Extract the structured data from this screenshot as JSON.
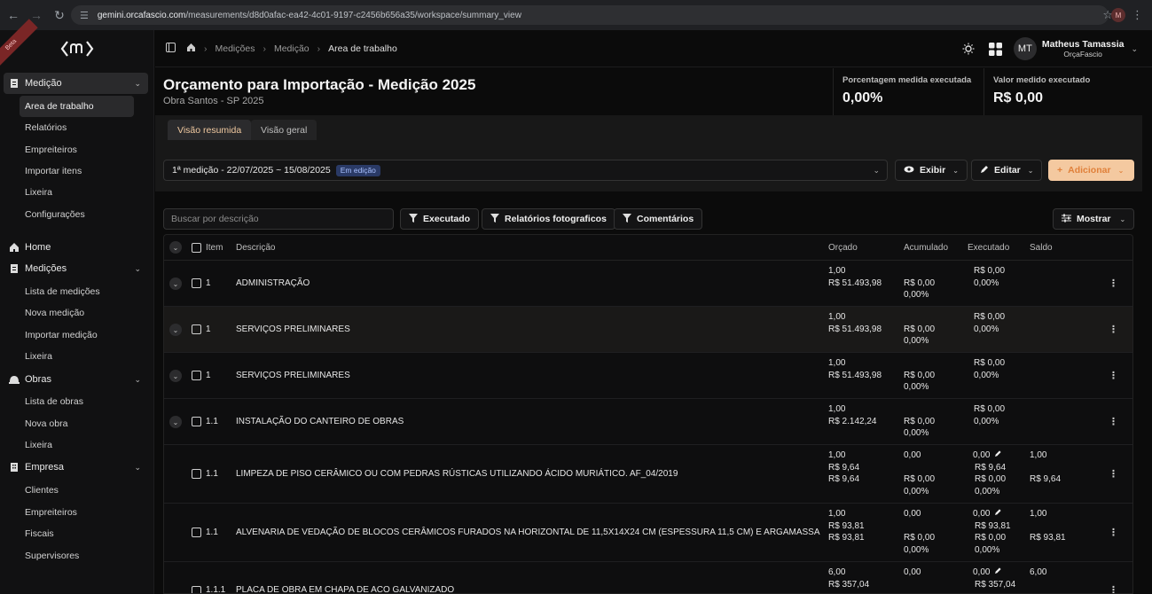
{
  "browser": {
    "url_host": "gemini.orcafascio.com",
    "url_path": "/measurements/d8d0afac-ea42-4c01-9197-c2456b656a35/workspace/summary_view",
    "profile_initial": "M"
  },
  "sidebar": {
    "ribbon": "Beta",
    "sections": [
      {
        "label": "Medição",
        "items": [
          "Area de trabalho",
          "Relatórios",
          "Empreiteiros",
          "Importar itens",
          "Lixeira",
          "Configurações"
        ]
      },
      {
        "label": "Home",
        "items": []
      },
      {
        "label": "Medições",
        "items": [
          "Lista de medições",
          "Nova medição",
          "Importar medição",
          "Lixeira"
        ]
      },
      {
        "label": "Obras",
        "items": [
          "Lista de obras",
          "Nova obra",
          "Lixeira"
        ]
      },
      {
        "label": "Empresa",
        "items": [
          "Clientes",
          "Empreiteiros",
          "Fiscais",
          "Supervisores"
        ]
      }
    ]
  },
  "header": {
    "breadcrumbs": [
      "Medições",
      "Medição",
      "Area de trabalho"
    ],
    "user": {
      "initials": "MT",
      "name": "Matheus Tamassia",
      "org": "OrçaFascio"
    }
  },
  "title": {
    "main": "Orçamento para Importação - Medição 2025",
    "sub": "Obra Santos - SP 2025"
  },
  "kpis": [
    {
      "label": "Porcentagem medida executada",
      "value": "0,00%"
    },
    {
      "label": "Valor medido executado",
      "value": "R$ 0,00"
    }
  ],
  "tabs": [
    "Visão resumida",
    "Visão geral"
  ],
  "toolbar": {
    "measurement": "1ª medição - 22/07/2025 ~ 15/08/2025",
    "badge": "Em edição",
    "exibir": "Exibir",
    "editar": "Editar",
    "adicionar": "Adicionar"
  },
  "filters": {
    "search_placeholder": "Buscar por descrição",
    "executado": "Executado",
    "relatorios": "Relatórios fotograficos",
    "comentarios": "Comentários",
    "mostrar": "Mostrar"
  },
  "table": {
    "headers": {
      "item": "Item",
      "descricao": "Descrição",
      "orcado": "Orçado",
      "acumulado": "Acumulado",
      "executado": "Executado",
      "saldo": "Saldo"
    },
    "rows": [
      {
        "item": "1",
        "desc": "ADMINISTRAÇÃO",
        "orcado": [
          "1,00",
          "R$ 51.493,98"
        ],
        "acumulado": [
          "",
          "R$ 0,00",
          "0,00%"
        ],
        "executado": [
          "R$ 0,00",
          "0,00%"
        ],
        "saldo": []
      },
      {
        "item": "1",
        "desc": "SERVIÇOS PRELIMINARES",
        "orcado": [
          "1,00",
          "R$ 51.493,98"
        ],
        "acumulado": [
          "",
          "R$ 0,00",
          "0,00%"
        ],
        "executado": [
          "R$ 0,00",
          "0,00%"
        ],
        "saldo": []
      },
      {
        "item": "1",
        "desc": "SERVIÇOS PRELIMINARES",
        "orcado": [
          "1,00",
          "R$ 51.493,98"
        ],
        "acumulado": [
          "",
          "R$ 0,00",
          "0,00%"
        ],
        "executado": [
          "R$ 0,00",
          "0,00%"
        ],
        "saldo": []
      },
      {
        "item": "1.1",
        "desc": "INSTALAÇÃO DO CANTEIRO DE OBRAS",
        "orcado": [
          "1,00",
          "R$ 2.142,24"
        ],
        "acumulado": [
          "",
          "R$ 0,00",
          "0,00%"
        ],
        "executado": [
          "R$ 0,00",
          "0,00%"
        ],
        "saldo": []
      },
      {
        "item": "1.1",
        "desc": "LIMPEZA DE PISO CERÂMICO OU COM PEDRAS RÚSTICAS UTILIZANDO ÁCIDO MURIÁTICO. AF_04/2019",
        "orcado": [
          "1,00",
          "R$ 9,64",
          "R$ 9,64"
        ],
        "acumulado": [
          "0,00",
          "",
          "R$ 0,00",
          "0,00%"
        ],
        "executado": [
          "0,00",
          "R$ 9,64",
          "R$ 0,00",
          "0,00%"
        ],
        "saldo": [
          "1,00",
          "",
          "R$ 9,64"
        ]
      },
      {
        "item": "1.1",
        "desc": "ALVENARIA DE VEDAÇÃO DE BLOCOS CERÂMICOS FURADOS NA HORIZONTAL DE 11,5X14X24 CM (ESPESSURA 11,5 CM) E ARGAMASSA DE ASSENT...",
        "orcado": [
          "1,00",
          "R$ 93,81",
          "R$ 93,81"
        ],
        "acumulado": [
          "0,00",
          "",
          "R$ 0,00",
          "0,00%"
        ],
        "executado": [
          "0,00",
          "R$ 93,81",
          "R$ 0,00",
          "0,00%"
        ],
        "saldo": [
          "1,00",
          "",
          "R$ 93,81"
        ]
      },
      {
        "item": "1.1.1",
        "desc": "PLACA DE OBRA EM CHAPA DE ACO GALVANIZADO",
        "orcado": [
          "6,00",
          "R$ 357,04"
        ],
        "acumulado": [
          "0,00"
        ],
        "executado": [
          "0,00",
          "R$ 357,04"
        ],
        "saldo": [
          "6,00"
        ]
      }
    ]
  }
}
